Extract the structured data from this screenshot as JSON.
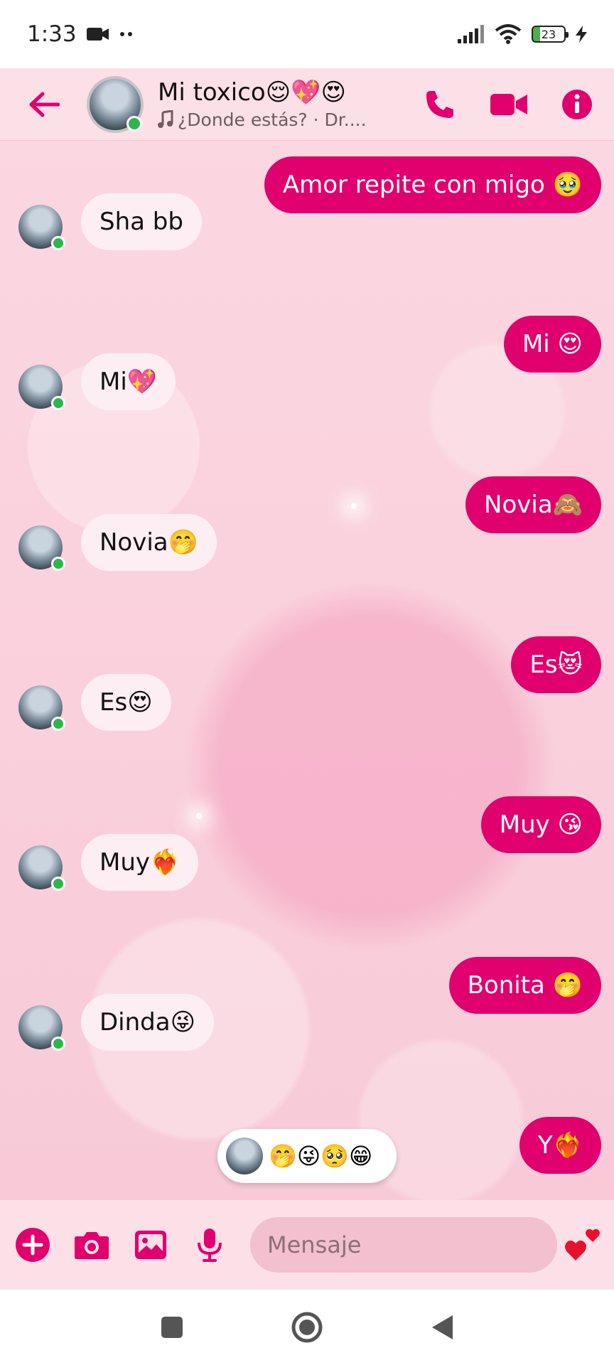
{
  "status_bar": {
    "time": "1:33",
    "battery": "23"
  },
  "header": {
    "contact_name": "Mi toxico😌💖😍",
    "now_playing": "¿Donde estás? · Dr...."
  },
  "messages": [
    {
      "direction": "out",
      "text": "Amor repite con migo 🥹"
    },
    {
      "direction": "in",
      "text": "Sha bb"
    },
    {
      "direction": "out",
      "text": "Mi 😍"
    },
    {
      "direction": "in",
      "text": "Mi💖"
    },
    {
      "direction": "out",
      "text": "Novia🙈"
    },
    {
      "direction": "in",
      "text": "Novia🤭"
    },
    {
      "direction": "out",
      "text": "Es😻"
    },
    {
      "direction": "in",
      "text": "Es😍"
    },
    {
      "direction": "out",
      "text": "Muy 😘"
    },
    {
      "direction": "in",
      "text": "Muy❤️‍🔥"
    },
    {
      "direction": "out",
      "text": "Bonita 🤭"
    },
    {
      "direction": "in",
      "text": "Dinda😜"
    },
    {
      "direction": "out",
      "text": "Y❤️‍🔥"
    }
  ],
  "reactions": {
    "emojis": "🤭😜🥺😁"
  },
  "composer": {
    "placeholder": "Mensaje",
    "like_emoji": "❤️"
  },
  "colors": {
    "accent": "#e0006e",
    "header_bg": "#fce0e8",
    "chat_bg": "#f8cad7",
    "bubble_in": "#fdeef3"
  }
}
